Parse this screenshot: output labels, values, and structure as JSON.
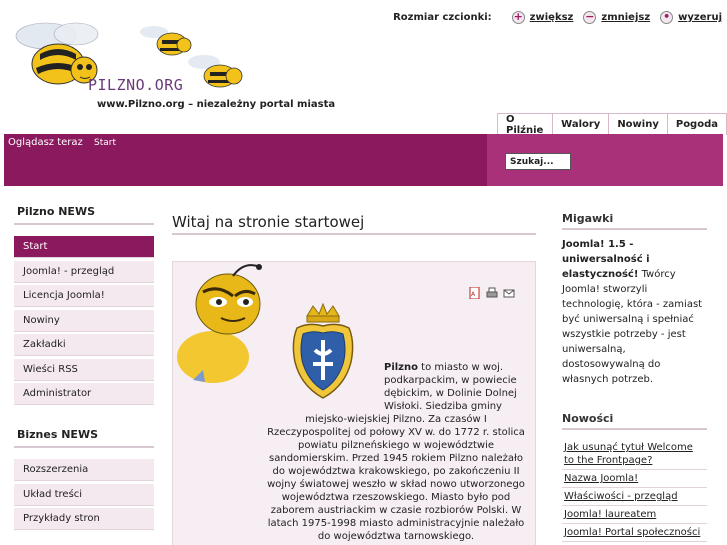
{
  "header": {
    "logo_text": "PILZNO.ORG",
    "tagline": "www.Pilzno.org – niezależny portal miasta",
    "fontsize": {
      "label": "Rozmiar czcionki:",
      "increase": "zwiększ",
      "decrease": "zmniejsz",
      "reset": "wyzeruj"
    }
  },
  "topnav": [
    "O Pilźnie",
    "Walory",
    "Nowiny",
    "Pogoda"
  ],
  "breadcrumb": {
    "label": "Oglądasz teraz",
    "current": "Start"
  },
  "search": {
    "value": "Szukaj..."
  },
  "left": {
    "section1_title": "Pilzno NEWS",
    "menu1": [
      "Start",
      "Joomla! - przegląd",
      "Licencja Joomla!",
      "Nowiny",
      "Zakładki",
      "Wieści RSS",
      "Administrator"
    ],
    "section2_title": "Biznes NEWS",
    "menu2": [
      "Rozszerzenia",
      "Układ treści",
      "Przykłady stron"
    ]
  },
  "main": {
    "title": "Witaj na stronie startowej",
    "p1_bold": "Pilzno",
    "p1_text": " to miasto w woj. podkarpackim, w powiecie dębickim, w Dolinie Dolnej Wisłoki. Siedziba gminy",
    "p2_text": "miejsko-wiejskiej Pilzno. Za czasów I Rzeczypospolitej od połowy XV w. do 1772 r. stolica powiatu pilzneńskiego w województwie sandomierskim. Przed 1945 rokiem Pilzno należało do województwa krakowskiego, po zakończeniu II wojny światowej weszło w skład nowo utworzonego województwa rzeszowskiego. Miasto było pod zaborem austriackim w czasie rozbiorów Polski. W latach 1975-1998  miasto administracyjnie należało do województwa tarnowskiego."
  },
  "right": {
    "migawki_title": "Migawki",
    "migawki_bold": "Joomla! 1.5 - uniwersalność i elastyczność!",
    "migawki_text": " Twórcy Joomla! stworzyli technologię, która - zamiast być uniwersalną i spełniać wszystkie potrzeby - jest uniwersalną, dostosowywalną do własnych potrzeb.",
    "nowosci_title": "Nowości",
    "links": [
      "Jak usunąć tytuł Welcome to the Frontpage?",
      "Nazwa Joomla!",
      "Właściwości - przegląd",
      "Joomla! laureatem",
      "Joomla! Portal społeczności"
    ]
  },
  "colors": {
    "accent": "#8a1a5d",
    "accent_light": "#a8317a",
    "menu_bg": "#f4e9ef"
  }
}
